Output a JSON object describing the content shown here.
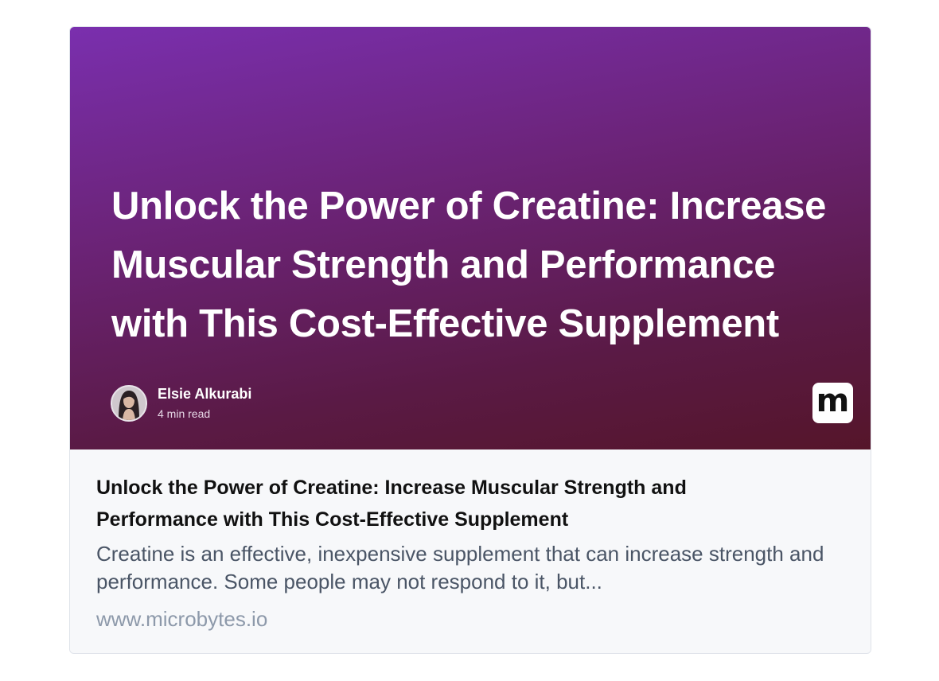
{
  "card": {
    "hero_title": "Unlock the Power of Creatine: Increase Muscular Strength and Performance with This Cost-Effective Supplement",
    "author_name": "Elsie Alkurabi",
    "read_time": "4 min read",
    "logo_letter": "m",
    "title": "Unlock the Power of Creatine: Increase Muscular Strength and Performance with This Cost-Effective Supplement",
    "description": "Creatine is an effective, inexpensive supplement that can increase strength and performance. Some people may not respond to it, but...",
    "url": "www.microbytes.io"
  },
  "colors": {
    "hero_gradient_start": "#7a2fae",
    "hero_gradient_end": "#55152a",
    "title_text": "#111111",
    "description_text": "#4a5566",
    "url_text": "#8d99aa"
  },
  "icons": {
    "avatar": "author-avatar-photo",
    "logo": "microbytes-logo-icon"
  }
}
